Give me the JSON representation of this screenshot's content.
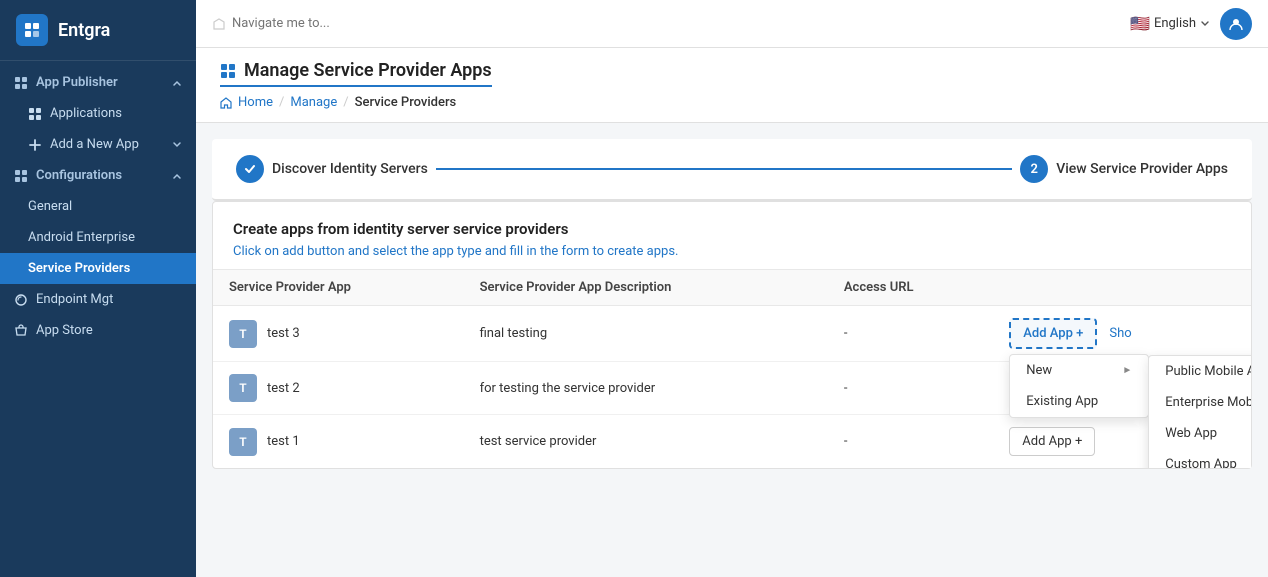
{
  "app": {
    "name": "Entgra"
  },
  "topbar": {
    "nav_placeholder": "Navigate me to...",
    "language": "English",
    "language_flag": "🇺🇸"
  },
  "sidebar": {
    "publisher_label": "App Publisher",
    "items": [
      {
        "id": "applications",
        "label": "Applications",
        "icon": "grid"
      },
      {
        "id": "add-new-app",
        "label": "Add a New App",
        "icon": "plus"
      },
      {
        "id": "configurations",
        "label": "Configurations",
        "icon": "grid"
      },
      {
        "id": "general",
        "label": "General",
        "icon": ""
      },
      {
        "id": "android-enterprise",
        "label": "Android Enterprise",
        "icon": ""
      },
      {
        "id": "service-providers",
        "label": "Service Providers",
        "icon": ""
      },
      {
        "id": "endpoint-mgt",
        "label": "Endpoint Mgt",
        "icon": "link"
      },
      {
        "id": "app-store",
        "label": "App Store",
        "icon": "store"
      }
    ]
  },
  "page": {
    "title": "Manage Service Provider Apps",
    "title_icon": "grid",
    "breadcrumb": {
      "home": "Home",
      "manage": "Manage",
      "current": "Service Providers"
    }
  },
  "stepper": {
    "step1": {
      "label": "Discover Identity Servers",
      "completed": true
    },
    "step2": {
      "label": "View Service Provider Apps",
      "number": "2"
    }
  },
  "table": {
    "description_title": "Create apps from identity server service providers",
    "description_body": "Click on add button and select the app type and fill in the form to create apps.",
    "columns": [
      {
        "id": "app",
        "label": "Service Provider App"
      },
      {
        "id": "desc",
        "label": "Service Provider App Description"
      },
      {
        "id": "url",
        "label": "Access URL"
      }
    ],
    "rows": [
      {
        "icon": "T",
        "name": "test 3",
        "description": "final testing",
        "access_url": "-",
        "has_dropdown": true
      },
      {
        "icon": "T",
        "name": "test 2",
        "description": "for testing the service provider",
        "access_url": "-",
        "has_dropdown": false
      },
      {
        "icon": "T",
        "name": "test 1",
        "description": "test service provider",
        "access_url": "-",
        "has_dropdown": false
      }
    ],
    "add_app_label": "Add App +",
    "show_label": "Sho",
    "dropdown": {
      "new_label": "New",
      "existing_label": "Existing App",
      "submenu_items": [
        "Public Mobile App",
        "Enterprise Mobile App",
        "Web App",
        "Custom App"
      ]
    }
  }
}
